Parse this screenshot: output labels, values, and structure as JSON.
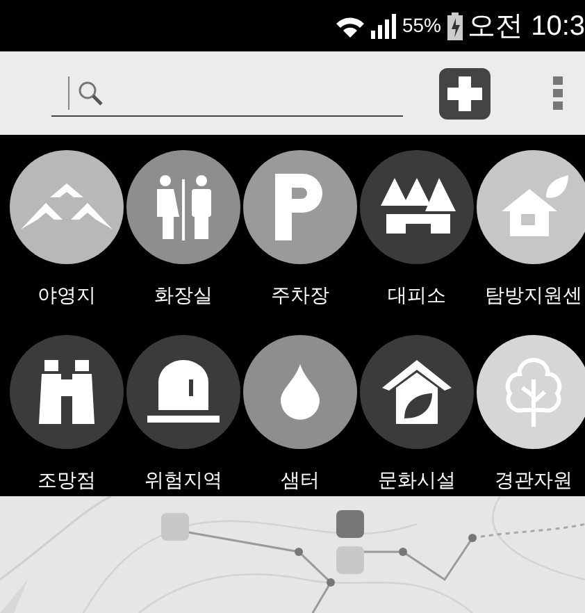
{
  "status_bar": {
    "battery": "55%",
    "time": "오전 10:3"
  },
  "categories": [
    {
      "label": "야영지",
      "kind": "mountains",
      "color": "#b8b8b8"
    },
    {
      "label": "화장실",
      "kind": "toilet",
      "color": "#8e8e8e"
    },
    {
      "label": "주차장",
      "kind": "parking",
      "color": "#9a9a9a"
    },
    {
      "label": "대피소",
      "kind": "shelter",
      "color": "#3b3b3b"
    },
    {
      "label": "탐방지원센",
      "kind": "house-leaf",
      "color": "#c6c6c6"
    },
    {
      "label": "조망점",
      "kind": "binoculars",
      "color": "#3b3b3b"
    },
    {
      "label": "위험지역",
      "kind": "alarm",
      "color": "#3b3b3b"
    },
    {
      "label": "샘터",
      "kind": "drop",
      "color": "#8e8e8e"
    },
    {
      "label": "문화시설",
      "kind": "culture",
      "color": "#3b3b3b"
    },
    {
      "label": "경관자원",
      "kind": "tree",
      "color": "#d6d6d6"
    }
  ]
}
